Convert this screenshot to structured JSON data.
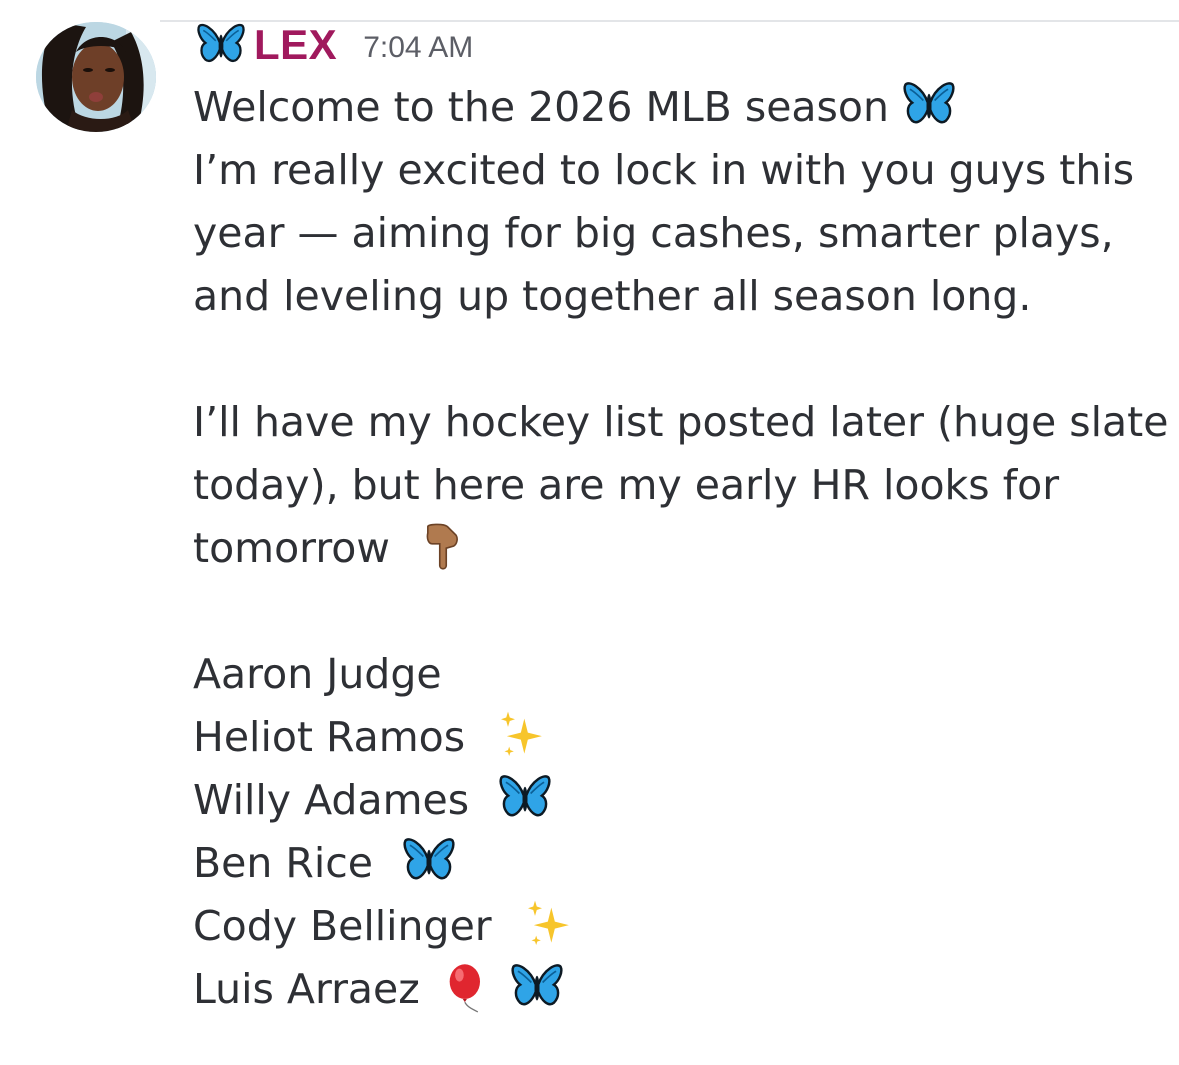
{
  "author": {
    "name": "LEX",
    "timestamp": "7:04 AM",
    "name_color": "#a0195d",
    "badge_icon": "butterfly-icon"
  },
  "message": {
    "paragraph1": {
      "line1": "Welcome to the 2026 MLB season",
      "line1_emoji": "butterfly-icon",
      "line2": "I’m really excited to lock in with you guys this",
      "line3": "year — aiming for big cashes, smarter plays,",
      "line4": "and leveling up together all season long."
    },
    "paragraph2": {
      "line1": "I’ll have my hockey list posted later (huge slate",
      "line2": "today), but here are my early HR looks for",
      "line3": "tomorrow",
      "line3_emoji": "pointing-down-icon"
    },
    "picks": [
      {
        "name": "Aaron Judge",
        "emojis": []
      },
      {
        "name": "Heliot Ramos",
        "emojis": [
          "sparkles-icon"
        ]
      },
      {
        "name": "Willy Adames",
        "emojis": [
          "butterfly-icon"
        ]
      },
      {
        "name": "Ben Rice",
        "emojis": [
          "butterfly-icon"
        ]
      },
      {
        "name": "Cody Bellinger",
        "emojis": [
          "sparkles-icon"
        ]
      },
      {
        "name": "Luis Arraez",
        "emojis": [
          "balloon-icon",
          "butterfly-icon"
        ]
      }
    ]
  },
  "colors": {
    "text": "#2e3035",
    "timestamp": "#5c5e66",
    "butterfly": "#2fa4e7"
  }
}
